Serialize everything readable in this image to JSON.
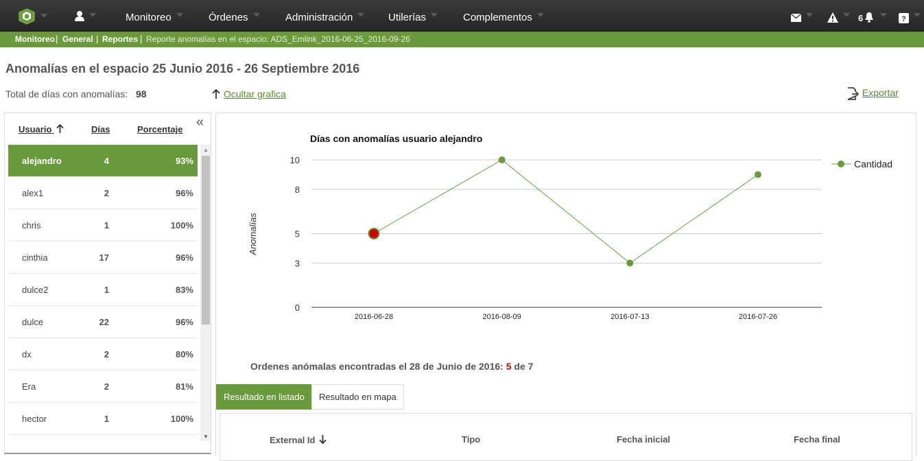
{
  "nav": {
    "menu": [
      "Monitoreo",
      "Órdenes",
      "Administración",
      "Utilerías",
      "Complementos"
    ],
    "notification_count": "6"
  },
  "breadcrumb": {
    "items": [
      "Monitoreo",
      "General",
      "Reportes"
    ],
    "current": "Reporte anomalías en el espacio: ADS_Emlink_2016-06-25_2016-09-26"
  },
  "page": {
    "title": "Anomalías en el espacio 25 Junio 2016 - 26 Septiembre 2016",
    "total_label": "Total de días con anomalías:",
    "total_value": "98",
    "hide_chart_label": "Ocultar grafica",
    "export_label": "Exportar"
  },
  "table": {
    "columns": [
      "Usuario",
      "Días",
      "Porcentaje"
    ],
    "rows": [
      {
        "user": "alejandro",
        "days": "4",
        "pct": "93%",
        "selected": true
      },
      {
        "user": "alex1",
        "days": "2",
        "pct": "96%"
      },
      {
        "user": "chris",
        "days": "1",
        "pct": "100%"
      },
      {
        "user": "cinthia",
        "days": "17",
        "pct": "96%"
      },
      {
        "user": "dulce2",
        "days": "1",
        "pct": "83%"
      },
      {
        "user": "dulce",
        "days": "22",
        "pct": "96%"
      },
      {
        "user": "dx",
        "days": "2",
        "pct": "80%"
      },
      {
        "user": "Era",
        "days": "2",
        "pct": "81%"
      },
      {
        "user": "hector",
        "days": "1",
        "pct": "100%"
      }
    ]
  },
  "chart_data": {
    "type": "line",
    "title": "Días con anomalías usuario alejandro",
    "ylabel": "Anomalías",
    "xlabel": "",
    "categories": [
      "2016-06-28",
      "2016-08-09",
      "2016-07-13",
      "2016-07-26"
    ],
    "series": [
      {
        "name": "Cantidad",
        "values": [
          5,
          10,
          3,
          9
        ],
        "color": "#6a9a3c"
      }
    ],
    "yticks": [
      "0",
      "3",
      "5",
      "8",
      "10"
    ],
    "ylim": [
      0,
      10
    ],
    "highlight_index": 0,
    "highlight_color": "#cc0000",
    "grid": true,
    "legend": "right"
  },
  "summary": {
    "prefix": "Ordenes anómalas encontradas el 28 de Junio de 2016:",
    "found": "5",
    "of": "de",
    "total": "7"
  },
  "tabs": [
    "Resultado en listado",
    "Resultado en mapa"
  ],
  "results_columns": [
    "External Id",
    "Tipo",
    "Fecha inicial",
    "Fecha final"
  ],
  "colors": {
    "accent": "#6a9a3c",
    "link": "#5b8a2f",
    "highlight": "#cc0000"
  }
}
